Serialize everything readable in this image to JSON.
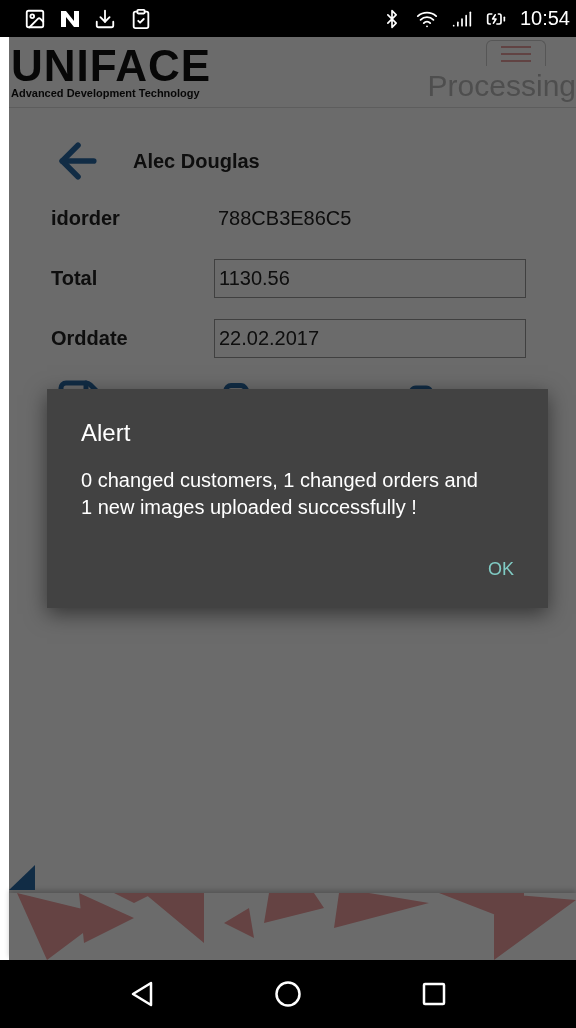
{
  "status_bar": {
    "time": "10:54"
  },
  "header": {
    "logo": "UNIFACE",
    "tagline": "Advanced Development Technology",
    "status": "Processing"
  },
  "customer": {
    "name": "Alec Douglas"
  },
  "fields": [
    {
      "kind": "text",
      "label": "idorder",
      "value": "788CB3E86C5"
    },
    {
      "kind": "input",
      "label": "Total",
      "value": "1130.56"
    },
    {
      "kind": "input",
      "label": "Orddate",
      "value": "22.02.2017"
    }
  ],
  "dialog": {
    "title": "Alert",
    "message": "0 changed customers, 1 changed orders and 1 new images uploaded successfully !",
    "button": "OK"
  }
}
